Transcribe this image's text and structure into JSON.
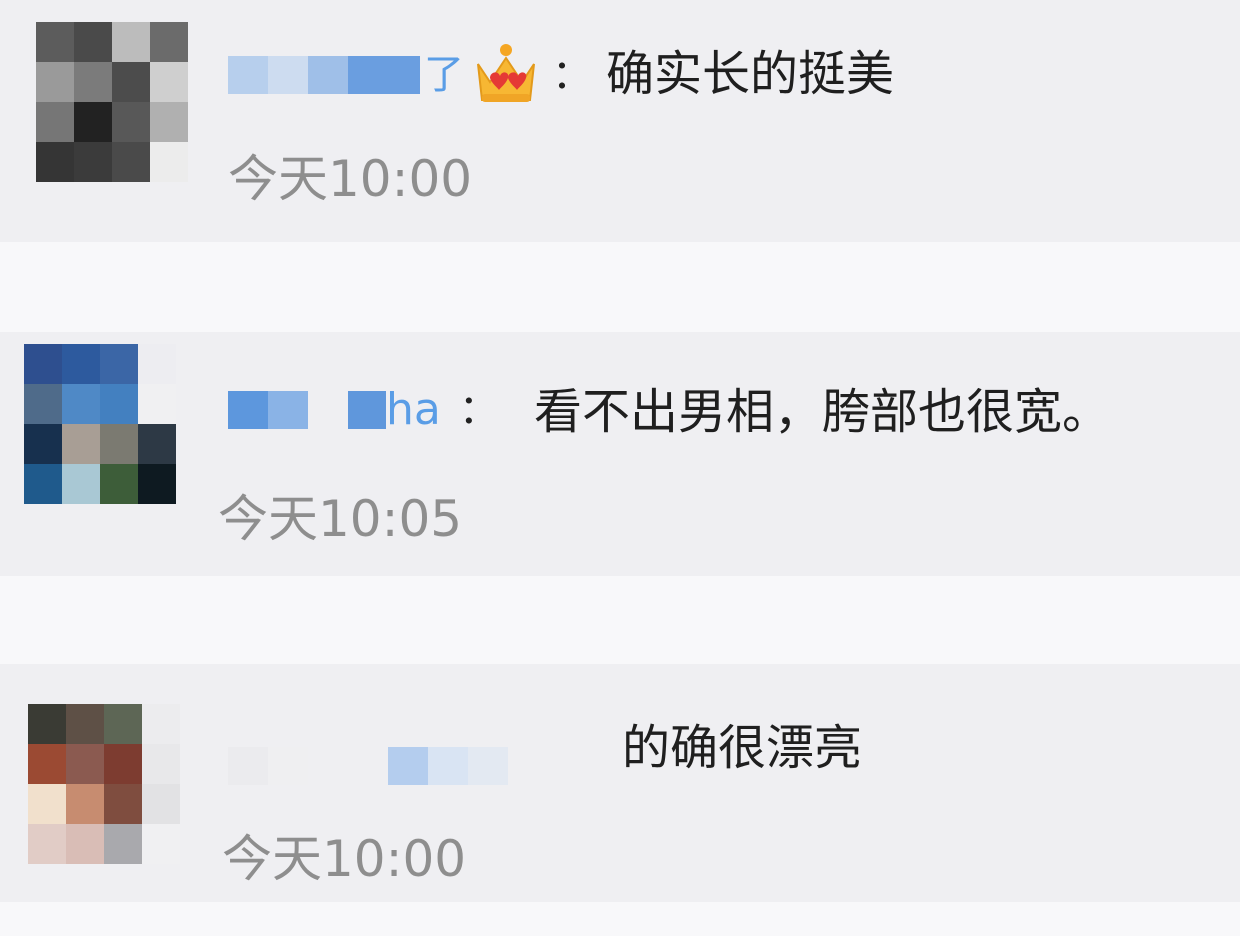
{
  "comments": [
    {
      "avatar_cells": [
        "#5c5c5c",
        "#4a4a4a",
        "#bcbcbc",
        "#6b6b6b",
        "#9a9a9a",
        "#7b7b7b",
        "#4c4c4c",
        "#cfcfcf",
        "#767676",
        "#222222",
        "#585858",
        "#b0b0b0",
        "#353535",
        "#3b3b3b",
        "#4a4a4a",
        "#ececec"
      ],
      "name_tail": "了",
      "badge_icon": "crown-icon",
      "text": "确实长的挺美",
      "time": "今天10:00"
    },
    {
      "avatar_cells": [
        "#2e4f8f",
        "#2d5a9e",
        "#3b66a6",
        "#ededf1",
        "#4f6b8a",
        "#4f89c6",
        "#4380c0",
        "#f0f0f2",
        "#17304e",
        "#a89e95",
        "#7b7a71",
        "#2d3945",
        "#1f5a8c",
        "#a9c8d4",
        "#3d5d39",
        "#0e1a21"
      ],
      "name_tail": "ha",
      "text": "看不出男相，胯部也很宽。",
      "time": "今天10:05"
    },
    {
      "avatar_cells": [
        "#3a3b34",
        "#5e5046",
        "#5d6655",
        "#ececee",
        "#9b4a33",
        "#8b5a50",
        "#7d3c30",
        "#e8e8ea",
        "#f1e0cc",
        "#c78c70",
        "#7f4d3f",
        "#e2e2e4",
        "#e1ccc6",
        "#d9bdb6",
        "#a9a9ad",
        "#f0f0f2"
      ],
      "text": "的确很漂亮",
      "time": "今天10:00"
    }
  ]
}
